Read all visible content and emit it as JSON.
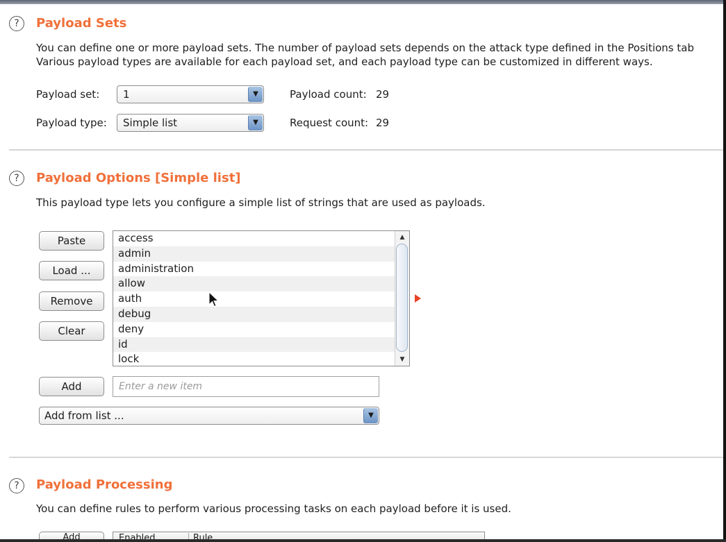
{
  "payload_sets": {
    "title": "Payload Sets",
    "description_line1": "You can define one or more payload sets. The number of payload sets depends on the attack type defined in the Positions tab",
    "description_line2": "Various payload types are available for each payload set, and each payload type can be customized in different ways.",
    "set_label": "Payload set:",
    "set_value": "1",
    "type_label": "Payload type:",
    "type_value": "Simple list",
    "payload_count_label": "Payload count:",
    "payload_count": "29",
    "request_count_label": "Request count:",
    "request_count": "29"
  },
  "payload_options": {
    "title": "Payload Options [Simple list]",
    "description": "This payload type lets you configure a simple list of strings that are used as payloads.",
    "buttons": {
      "paste": "Paste",
      "load": "Load ...",
      "remove": "Remove",
      "clear": "Clear",
      "add": "Add"
    },
    "items": [
      "access",
      "admin",
      "administration",
      "allow",
      "auth",
      "debug",
      "deny",
      "id",
      "lock"
    ],
    "new_item_placeholder": "Enter a new item",
    "add_from_list": "Add from list ..."
  },
  "payload_processing": {
    "title": "Payload Processing",
    "description": "You can define rules to perform various processing tasks on each payload before it is used.",
    "add_button": "Add",
    "columns": [
      "Enabled",
      "Rule"
    ]
  },
  "icons": {
    "help": "help-icon",
    "dropdown": "chevron-down-icon",
    "scroll_up": "scroll-up-icon",
    "scroll_down": "scroll-down-icon",
    "expand_marker": "red-triangle-icon",
    "cursor": "mouse-pointer-icon"
  },
  "colors": {
    "heading": "#f0703a",
    "marker": "#e8432a"
  }
}
